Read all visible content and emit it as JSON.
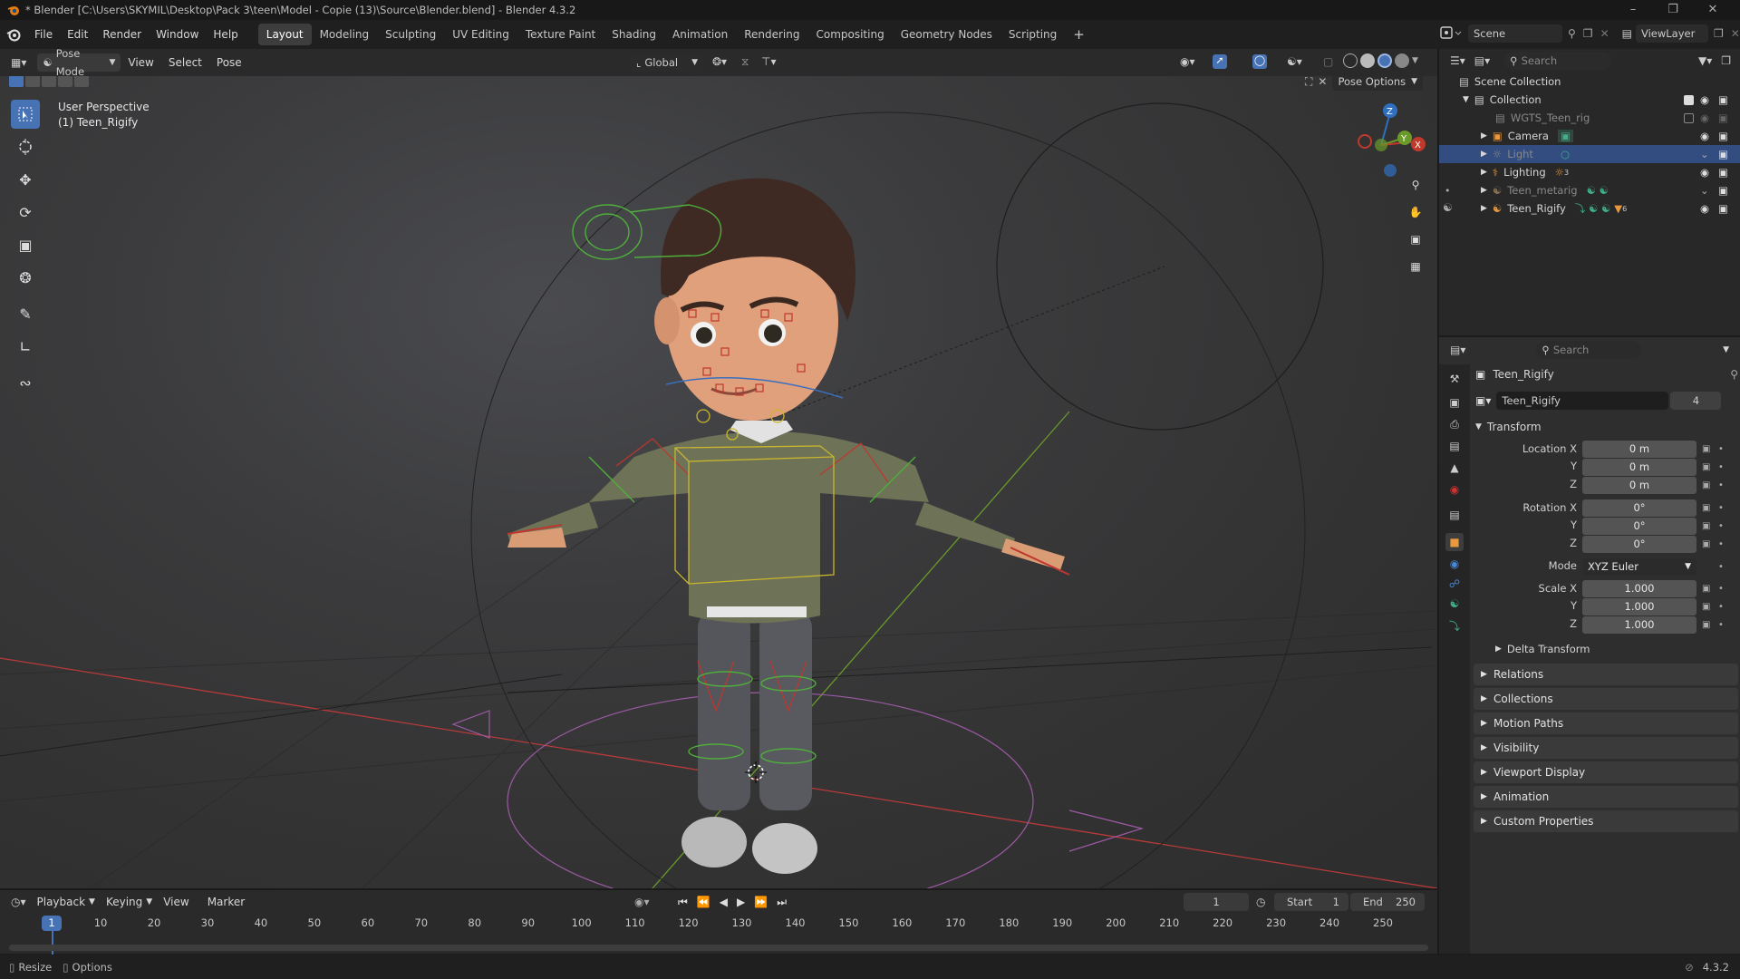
{
  "window": {
    "title": "* Blender [C:\\Users\\SKYMIL\\Desktop\\Pack 3\\teen\\Model - Copie (13)\\Source\\Blender.blend] - Blender 4.3.2"
  },
  "menubar": {
    "menus": [
      "File",
      "Edit",
      "Render",
      "Window",
      "Help"
    ],
    "workspaces": [
      "Layout",
      "Modeling",
      "Sculpting",
      "UV Editing",
      "Texture Paint",
      "Shading",
      "Animation",
      "Rendering",
      "Compositing",
      "Geometry Nodes",
      "Scripting"
    ],
    "active_workspace": "Layout",
    "scene": "Scene",
    "view_layer": "ViewLayer"
  },
  "viewport_header": {
    "mode": "Pose Mode",
    "menus": [
      "View",
      "Select",
      "Pose"
    ],
    "orientation": "Global",
    "pose_options": "Pose Options"
  },
  "viewport": {
    "view_name": "User Perspective",
    "active_object": "(1) Teen_Rigify",
    "gizmo_axes": [
      "X",
      "Y",
      "Z"
    ]
  },
  "outliner": {
    "search_placeholder": "Search",
    "root": "Scene Collection",
    "collection": "Collection",
    "items": [
      {
        "name": "WGTS_Teen_rig",
        "selected": false,
        "dim": true
      },
      {
        "name": "Camera",
        "selected": false,
        "dim": false
      },
      {
        "name": "Light",
        "selected": true,
        "dim": true
      },
      {
        "name": "Lighting",
        "selected": false,
        "dim": false,
        "badge": "3"
      },
      {
        "name": "Teen_metarig",
        "selected": false,
        "dim": true
      },
      {
        "name": "Teen_Rigify",
        "selected": false,
        "dim": false,
        "badge": "6"
      }
    ]
  },
  "properties": {
    "search_placeholder": "Search",
    "object_name": "Teen_Rigify",
    "datablock_name": "Teen_Rigify",
    "user_count": "4",
    "transform_title": "Transform",
    "location_label": "Location X",
    "rotation_label": "Rotation X",
    "scale_label": "Scale X",
    "axis_y": "Y",
    "axis_z": "Z",
    "location": [
      "0 m",
      "0 m",
      "0 m"
    ],
    "rotation": [
      "0°",
      "0°",
      "0°"
    ],
    "mode_label": "Mode",
    "mode_value": "XYZ Euler",
    "scale": [
      "1.000",
      "1.000",
      "1.000"
    ],
    "delta_transform": "Delta Transform",
    "panels": [
      "Relations",
      "Collections",
      "Motion Paths",
      "Visibility",
      "Viewport Display",
      "Animation",
      "Custom Properties"
    ]
  },
  "timeline": {
    "menus": [
      "Playback",
      "Keying",
      "View",
      "Marker"
    ],
    "current_frame": "1",
    "start_label": "Start",
    "start": "1",
    "end_label": "End",
    "end": "250",
    "ticks": [
      "10",
      "20",
      "30",
      "40",
      "50",
      "60",
      "70",
      "80",
      "90",
      "100",
      "110",
      "120",
      "130",
      "140",
      "150",
      "160",
      "170",
      "180",
      "190",
      "200",
      "210",
      "220",
      "230",
      "240",
      "250"
    ],
    "playhead": "1"
  },
  "statusbar": {
    "left": [
      "Resize",
      "Options"
    ],
    "version": "4.3.2"
  },
  "colors": {
    "accent": "#4772b3",
    "selection": "#334d80",
    "x_axis": "#c0392b",
    "y_axis": "#6a9a29",
    "z_axis": "#2f6fbf"
  }
}
